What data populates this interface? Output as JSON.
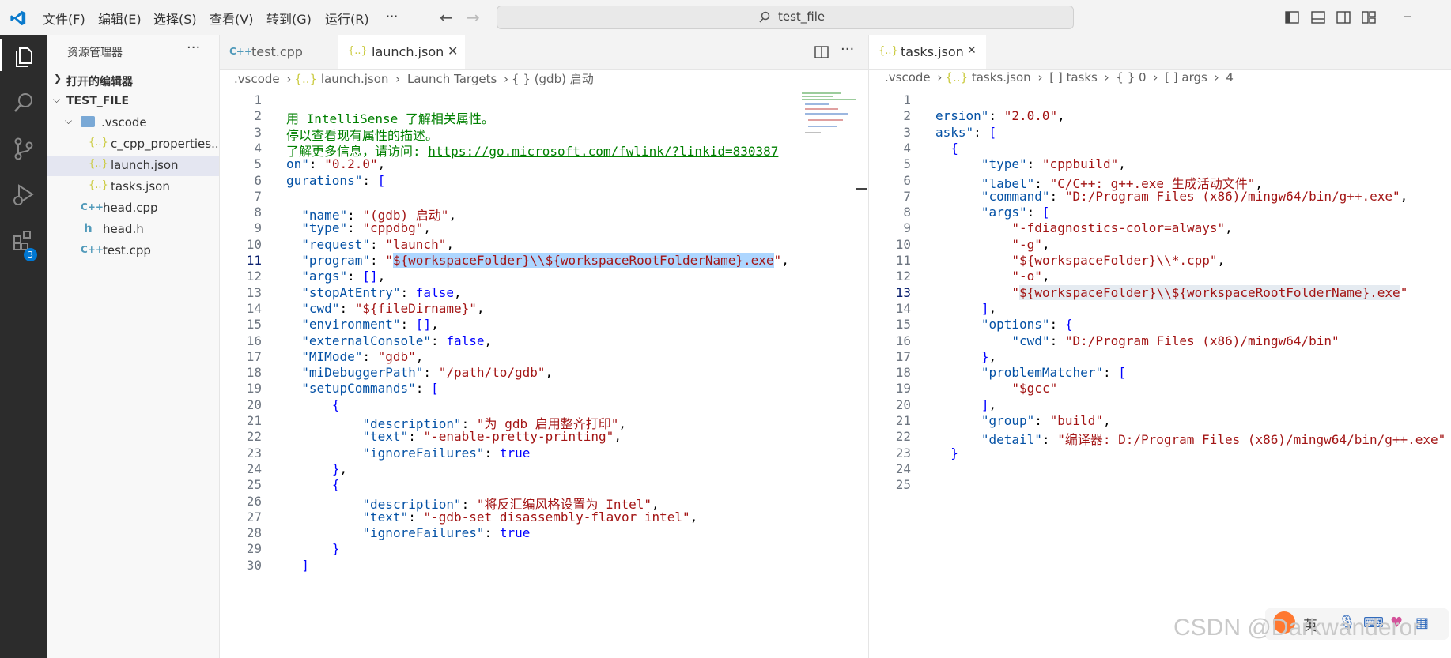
{
  "titlebar": {
    "menus": [
      "文件(F)",
      "编辑(E)",
      "选择(S)",
      "查看(V)",
      "转到(G)",
      "运行(R)",
      "···"
    ],
    "search_text": "test_file"
  },
  "activity": {
    "extensions_badge": "3"
  },
  "sidebar": {
    "title": "资源管理器",
    "open_editors": "打开的编辑器",
    "folder": "TEST_FILE",
    "items": [
      {
        "label": ".vscode",
        "icon": "{..}"
      },
      {
        "label": "c_cpp_properties...",
        "icon": "{..}"
      },
      {
        "label": "launch.json",
        "icon": "{..}"
      },
      {
        "label": "tasks.json",
        "icon": "{..}"
      },
      {
        "label": "head.cpp",
        "icon": "C++"
      },
      {
        "label": "head.h",
        "icon": "h"
      },
      {
        "label": "test.cpp",
        "icon": "C++"
      }
    ]
  },
  "left_editor": {
    "tabs": [
      {
        "label": "test.cpp",
        "icon": "C++"
      },
      {
        "label": "launch.json",
        "icon": "{..}"
      }
    ],
    "breadcrumb": [
      ".vscode",
      "launch.json",
      "Launch Targets",
      "(gdb) 启动"
    ],
    "lines": [
      "",
      "用 IntelliSense 了解相关属性。",
      "停以查看现有属性的描述。",
      "了解更多信息，请访问: https://go.microsoft.com/fwlink/?linkid=830387",
      "on\": \"0.2.0\",",
      "gurations\": [",
      "",
      "  \"name\": \"(gdb) 启动\",",
      "  \"type\": \"cppdbg\",",
      "  \"request\": \"launch\",",
      "  \"program\": \"${workspaceFolder}\\\\${workspaceRootFolderName}.exe\",",
      "  \"args\": [],",
      "  \"stopAtEntry\": false,",
      "  \"cwd\": \"${fileDirname}\",",
      "  \"environment\": [],",
      "  \"externalConsole\": false,",
      "  \"MIMode\": \"gdb\",",
      "  \"miDebuggerPath\": \"/path/to/gdb\",",
      "  \"setupCommands\": [",
      "      {",
      "          \"description\": \"为 gdb 启用整齐打印\",",
      "          \"text\": \"-enable-pretty-printing\",",
      "          \"ignoreFailures\": true",
      "      },",
      "      {",
      "          \"description\": \"将反汇编风格设置为 Intel\",",
      "          \"text\": \"-gdb-set disassembly-flavor intel\",",
      "          \"ignoreFailures\": true",
      "      }",
      "  ]"
    ]
  },
  "right_editor": {
    "tabs": [
      {
        "label": "tasks.json",
        "icon": "{..}"
      }
    ],
    "breadcrumb": [
      ".vscode",
      "tasks.json",
      "[ ] tasks",
      "{ } 0",
      "[ ] args",
      "4"
    ],
    "lines": [
      "",
      "ersion\": \"2.0.0\",",
      "asks\": [",
      "  {",
      "      \"type\": \"cppbuild\",",
      "      \"label\": \"C/C++: g++.exe 生成活动文件\",",
      "      \"command\": \"D:/Program Files (x86)/mingw64/bin/g++.exe\",",
      "      \"args\": [",
      "          \"-fdiagnostics-color=always\",",
      "          \"-g\",",
      "          \"${workspaceFolder}\\\\*.cpp\",",
      "          \"-o\",",
      "          \"${workspaceFolder}\\\\${workspaceRootFolderName}.exe\"",
      "      ],",
      "      \"options\": {",
      "          \"cwd\": \"D:/Program Files (x86)/mingw64/bin\"",
      "      },",
      "      \"problemMatcher\": [",
      "          \"$gcc\"",
      "      ],",
      "      \"group\": \"build\",",
      "      \"detail\": \"编译器: D:/Program Files (x86)/mingw64/bin/g++.exe\"",
      "  }",
      "",
      ""
    ]
  },
  "watermark": "CSDN @Darkwanderor",
  "ime": "英"
}
